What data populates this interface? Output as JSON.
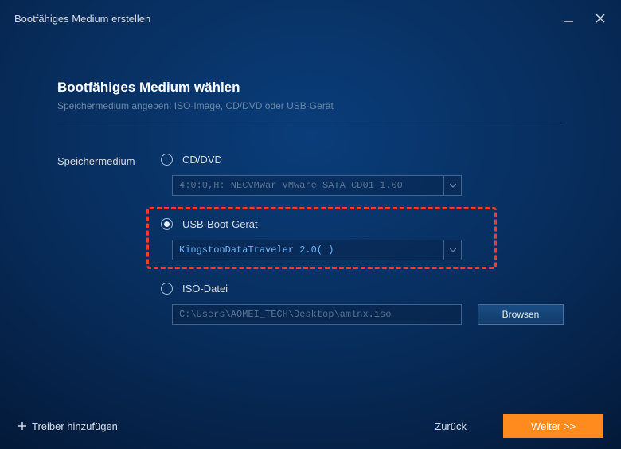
{
  "titlebar": {
    "title": "Bootfähiges Medium erstellen"
  },
  "page": {
    "heading": "Bootfähiges Medium wählen",
    "subheading": "Speichermedium angeben: ISO-Image, CD/DVD oder USB-Gerät"
  },
  "left_label": "Speichermedium",
  "options": {
    "cd": {
      "label": "CD/DVD",
      "selected": false,
      "value": "4:0:0,H: NECVMWar VMware SATA CD01 1.00"
    },
    "usb": {
      "label": "USB-Boot-Gerät",
      "selected": true,
      "value": "KingstonDataTraveler 2.0( )"
    },
    "iso": {
      "label": "ISO-Datei",
      "selected": false,
      "path": "C:\\Users\\AOMEI_TECH\\Desktop\\amlnx.iso",
      "browse": "Browsen"
    }
  },
  "footer": {
    "add_driver": "Treiber hinzufügen",
    "back": "Zurück",
    "next": "Weiter >>"
  }
}
